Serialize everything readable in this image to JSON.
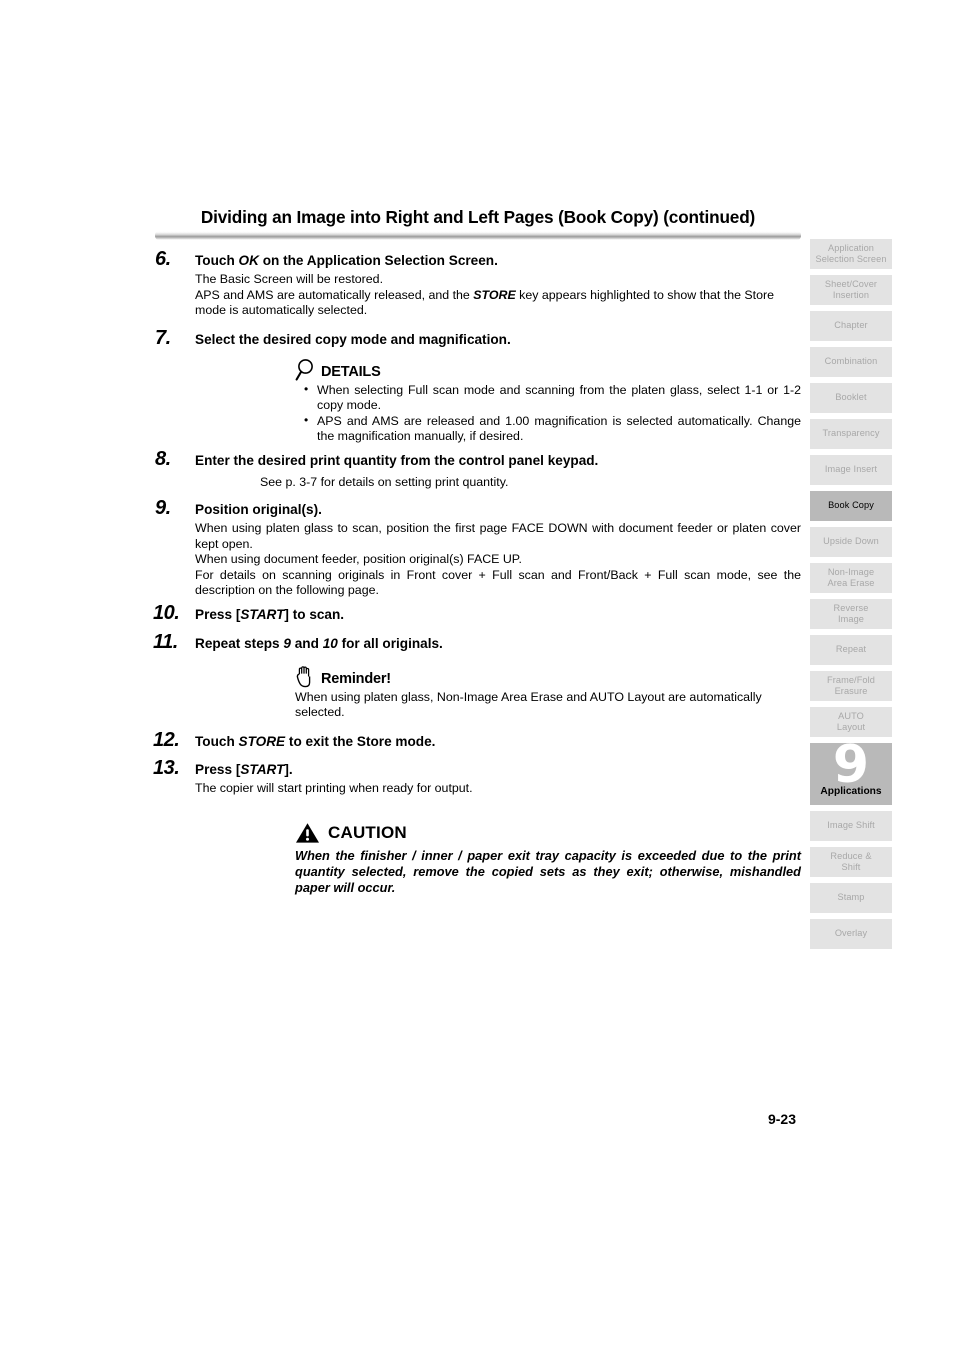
{
  "header": {
    "title": "Dividing an Image into Right and Left Pages (Book Copy) (continued)"
  },
  "steps": [
    {
      "number": "6.",
      "heading_pre": "Touch ",
      "heading_em": "OK",
      "heading_post": " on the Application Selection Screen.",
      "body_line1": "The Basic Screen will be restored.",
      "body_line2_pre": "APS and AMS are automatically released, and the ",
      "body_line2_em": "STORE",
      "body_line2_post": " key appears highlighted to show that the Store mode is automatically selected."
    },
    {
      "number": "7.",
      "heading": "Select the desired copy mode and magnification."
    },
    {
      "number": "8.",
      "heading": "Enter the desired print quantity from the control panel keypad.",
      "note": "See p. 3-7 for details on setting print quantity."
    },
    {
      "number": "9.",
      "heading": "Position original(s).",
      "body_line1": "When using platen glass to scan, position the first page FACE DOWN with document feeder or platen cover kept open.",
      "body_line2": "When using document feeder, position original(s) FACE UP.",
      "body_line3": "For details on scanning originals in Front cover + Full scan and Front/Back + Full scan mode, see the description on the following page."
    },
    {
      "number": "10.",
      "heading_pre": "Press [",
      "heading_em": "START",
      "heading_post": "] to scan."
    },
    {
      "number": "11.",
      "heading_pre": "Repeat steps ",
      "heading_em": "9",
      "heading_mid": " and ",
      "heading_em2": "10",
      "heading_post": " for all originals."
    },
    {
      "number": "12.",
      "heading_pre": "Touch ",
      "heading_em": "STORE",
      "heading_post": " to exit the Store mode."
    },
    {
      "number": "13.",
      "heading_pre": "Press [",
      "heading_em": "START",
      "heading_post": "].",
      "body_line1": "The copier will start printing when ready for output."
    }
  ],
  "details_callout": {
    "icon": "magnifier-icon",
    "title": "DETAILS",
    "bullets": [
      "When selecting Full scan mode and scanning from the platen glass, select 1-1 or 1-2 copy mode.",
      "APS and AMS are released and 1.00 magnification is selected automatically. Change the magnification manually, if desired."
    ]
  },
  "reminder_callout": {
    "icon": "hand-stop-icon",
    "title": "Reminder!",
    "body": "When using platen glass, Non-Image Area Erase and AUTO Layout are automatically selected."
  },
  "caution": {
    "icon": "warning-triangle-icon",
    "title": "CAUTION",
    "body": "When the finisher / inner / paper exit tray capacity is exceeded due to the print quantity selected, remove the copied sets as they exit; otherwise, mishandled paper will occur."
  },
  "tabs": [
    {
      "id": "application-selection-screen",
      "lines": [
        "Application",
        "Selection Screen"
      ],
      "active": false
    },
    {
      "id": "sheet-cover-insertion",
      "lines": [
        "Sheet/Cover",
        "Insertion"
      ],
      "active": false
    },
    {
      "id": "chapter",
      "lines": [
        "Chapter"
      ],
      "active": false
    },
    {
      "id": "combination",
      "lines": [
        "Combination"
      ],
      "active": false
    },
    {
      "id": "booklet",
      "lines": [
        "Booklet"
      ],
      "active": false
    },
    {
      "id": "transparency",
      "lines": [
        "Transparency"
      ],
      "active": false
    },
    {
      "id": "image-insert",
      "lines": [
        "Image Insert"
      ],
      "active": false
    },
    {
      "id": "book-copy",
      "lines": [
        "Book Copy"
      ],
      "active": true
    },
    {
      "id": "upside-down",
      "lines": [
        "Upside Down"
      ],
      "active": false
    },
    {
      "id": "non-image-area-erase",
      "lines": [
        "Non-Image",
        "Area Erase"
      ],
      "active": false
    },
    {
      "id": "reverse-image",
      "lines": [
        "Reverse",
        "Image"
      ],
      "active": false
    },
    {
      "id": "repeat",
      "lines": [
        "Repeat"
      ],
      "active": false
    },
    {
      "id": "frame-fold-erasure",
      "lines": [
        "Frame/Fold",
        "Erasure"
      ],
      "active": false
    },
    {
      "id": "auto-layout",
      "lines": [
        "AUTO",
        "Layout"
      ],
      "active": false
    }
  ],
  "chapter_tab": {
    "number": "9",
    "label": "Applications"
  },
  "tabs_after": [
    {
      "id": "image-shift",
      "lines": [
        "Image Shift"
      ],
      "active": false
    },
    {
      "id": "reduce-shift",
      "lines": [
        "Reduce &",
        "Shift"
      ],
      "active": false
    },
    {
      "id": "stamp",
      "lines": [
        "Stamp"
      ],
      "active": false
    },
    {
      "id": "overlay",
      "lines": [
        "Overlay"
      ],
      "active": false
    }
  ],
  "footer": {
    "page_number": "9-23"
  },
  "colors": {
    "tab_inactive_bg": "#e3e3e3",
    "tab_inactive_text": "#a8a8a8",
    "tab_active_bg": "#b9b9b9",
    "tab_active_text": "#000000",
    "text": "#000000"
  }
}
